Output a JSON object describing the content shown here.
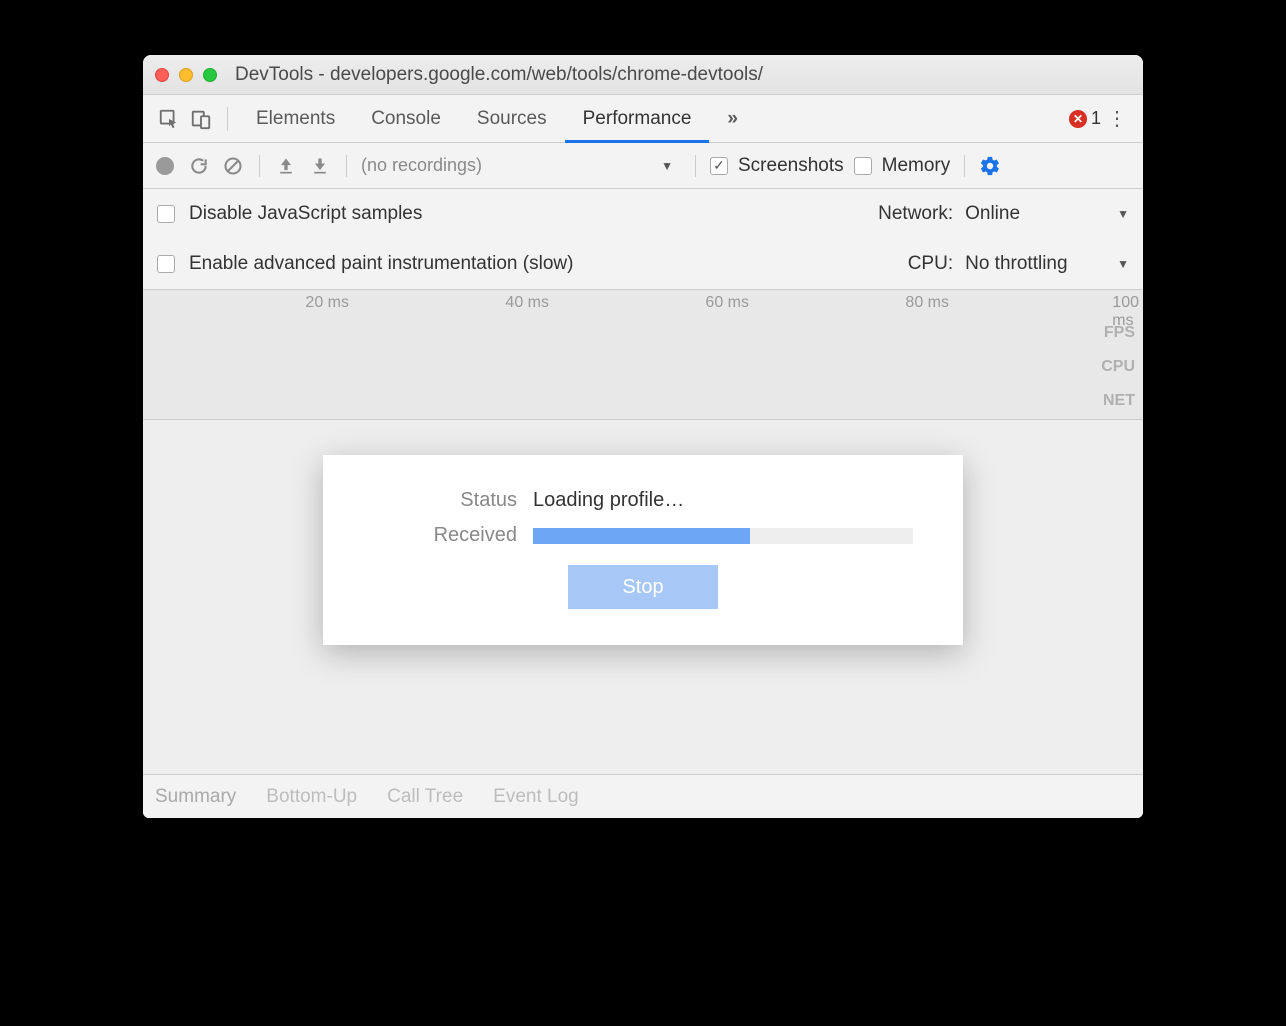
{
  "window": {
    "title": "DevTools - developers.google.com/web/tools/chrome-devtools/"
  },
  "tabs": {
    "items": [
      "Elements",
      "Console",
      "Sources",
      "Performance"
    ],
    "active": "Performance",
    "overflow_glyph": "»",
    "error_count": "1"
  },
  "toolbar": {
    "recordings_placeholder": "(no recordings)",
    "screenshots_label": "Screenshots",
    "memory_label": "Memory"
  },
  "settings": {
    "disable_js_label": "Disable JavaScript samples",
    "enable_paint_label": "Enable advanced paint instrumentation (slow)",
    "network_label": "Network:",
    "network_value": "Online",
    "cpu_label": "CPU:",
    "cpu_value": "No throttling"
  },
  "ruler": {
    "ticks": [
      "20 ms",
      "40 ms",
      "60 ms",
      "80 ms",
      "100 ms"
    ],
    "lanes": [
      "FPS",
      "CPU",
      "NET"
    ]
  },
  "modal": {
    "status_label": "Status",
    "status_value": "Loading profile…",
    "received_label": "Received",
    "progress_percent": 57,
    "stop_label": "Stop"
  },
  "bottom_tabs": {
    "items": [
      "Summary",
      "Bottom-Up",
      "Call Tree",
      "Event Log"
    ],
    "active": "Summary"
  }
}
